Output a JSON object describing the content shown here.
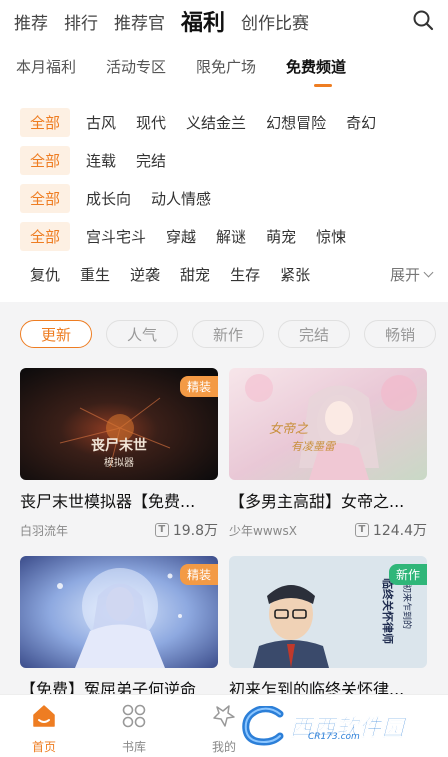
{
  "top_nav": {
    "tabs": [
      "推荐",
      "排行",
      "推荐官",
      "福利",
      "创作比赛"
    ],
    "active": "福利"
  },
  "sub_nav": {
    "tabs": [
      "本月福利",
      "活动专区",
      "限免广场",
      "免费频道"
    ],
    "active": "免费频道"
  },
  "filters": {
    "row1": {
      "all": "全部",
      "items": [
        "古风",
        "现代",
        "义结金兰",
        "幻想冒险",
        "奇幻"
      ]
    },
    "row2": {
      "all": "全部",
      "items": [
        "连载",
        "完结"
      ]
    },
    "row3": {
      "all": "全部",
      "items": [
        "成长向",
        "动人情感"
      ]
    },
    "row4": {
      "all": "全部",
      "items": [
        "宫斗宅斗",
        "穿越",
        "解谜",
        "萌宠",
        "惊悚"
      ]
    },
    "row5": {
      "items": [
        "复仇",
        "重生",
        "逆袭",
        "甜宠",
        "生存",
        "紧张"
      ]
    },
    "expand_label": "展开"
  },
  "sort_tabs": [
    "更新",
    "人气",
    "新作",
    "完结",
    "畅销"
  ],
  "cards": [
    {
      "title": "丧尸末世模拟器【免费...",
      "author": "白羽流年",
      "views": "19.8万",
      "badge": "精装",
      "cover_text": "丧尸末世",
      "cover_sub": "模拟器"
    },
    {
      "title": "【多男主高甜】女帝之...",
      "author": "少年wwwsX",
      "views": "124.4万",
      "badge": "",
      "cover_text": "女帝之",
      "cover_sub": "有凌墨雷"
    },
    {
      "title": "【免费】冤屈弟子何逆命",
      "author": "",
      "views": "",
      "badge": "精装",
      "cover_text": "",
      "cover_sub": ""
    },
    {
      "title": "初来乍到的临终关怀律...",
      "author": "",
      "views": "",
      "badge": "新作",
      "cover_text": "临终关怀律师",
      "cover_sub": "初来乍到的"
    }
  ],
  "bottom_nav": {
    "items": [
      "首页",
      "书库",
      "我的"
    ],
    "active": "首页"
  },
  "watermark": {
    "text": "西西软件园",
    "sub": "CR173.com"
  },
  "colors": {
    "accent": "#ee7d22",
    "panel_bg": "#f4f4f5",
    "badge_new": "#2fb679"
  }
}
